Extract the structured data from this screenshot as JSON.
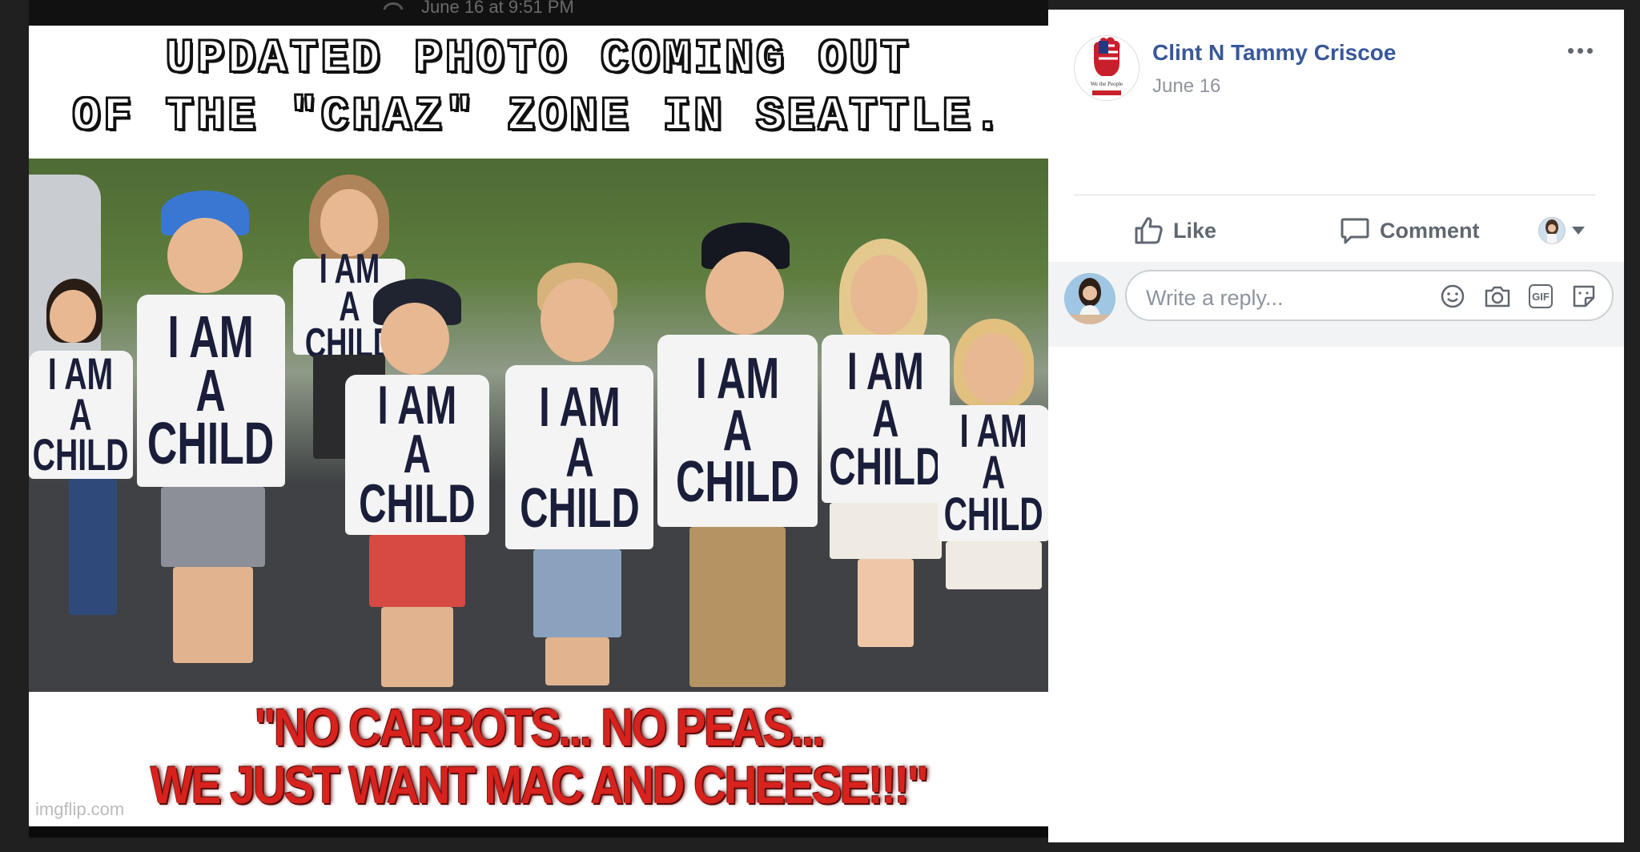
{
  "viewer": {
    "top_strip_text": "June 16 at 9:51 PM"
  },
  "photo": {
    "caption_top": [
      "UPDATED PHOTO COMING OUT",
      "OF THE \"CHAZ\" ZONE IN SEATTLE."
    ],
    "caption_bottom": [
      "\"NO CARROTS... NO PEAS...",
      "WE JUST WANT MAC AND CHEESE!!!\""
    ],
    "shirt_text": [
      "I AM\nA CHILD"
    ],
    "watermark": "imgflip.com",
    "avatar_emblem_text": "We the People"
  },
  "post": {
    "poster_name": "Clint N Tammy Criscoe",
    "date": "June 16",
    "like_label": "Like",
    "comment_label": "Comment",
    "reply_placeholder": "Write a reply...",
    "gif_label": "GIF"
  },
  "colors": {
    "link_blue": "#385898",
    "meta_gray": "#90949c",
    "action_gray": "#606770",
    "caption_red": "#d8221d"
  },
  "icons": {
    "like": "thumbs-up-icon",
    "comment": "speech-bubble-icon",
    "more": "ellipsis-icon",
    "emoji": "smiley-icon",
    "camera": "camera-icon",
    "gif": "gif-icon",
    "sticker": "sticker-icon"
  }
}
